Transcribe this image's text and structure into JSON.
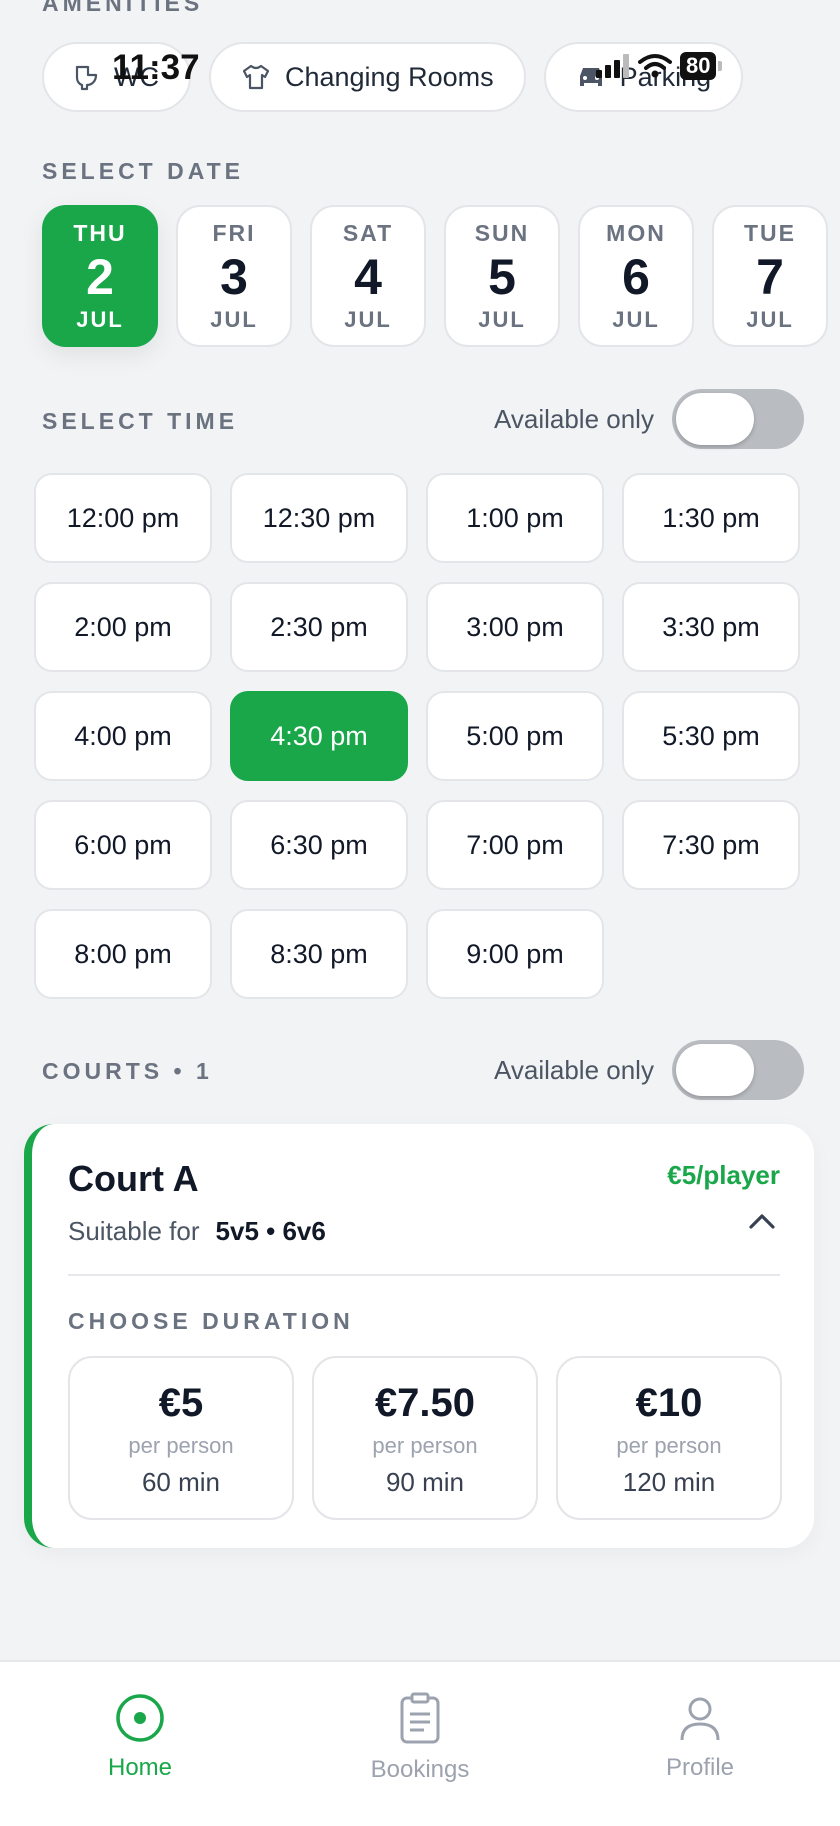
{
  "status_bar": {
    "time": "11:37",
    "battery": "80"
  },
  "amenities": {
    "label": "AMENITIES",
    "items": [
      {
        "label": "WC",
        "icon": "toilet-icon"
      },
      {
        "label": "Changing Rooms",
        "icon": "shirt-icon"
      },
      {
        "label": "Parking",
        "icon": "car-icon"
      }
    ]
  },
  "date": {
    "label": "SELECT DATE",
    "days": [
      {
        "dow": "THU",
        "num": "2",
        "month": "JUL",
        "selected": true
      },
      {
        "dow": "FRI",
        "num": "3",
        "month": "JUL"
      },
      {
        "dow": "SAT",
        "num": "4",
        "month": "JUL"
      },
      {
        "dow": "SUN",
        "num": "5",
        "month": "JUL"
      },
      {
        "dow": "MON",
        "num": "6",
        "month": "JUL"
      },
      {
        "dow": "TUE",
        "num": "7",
        "month": "JUL"
      }
    ]
  },
  "time": {
    "label": "SELECT TIME",
    "available_only_label": "Available only",
    "available_only": false,
    "slots": [
      "12:00 pm",
      "12:30 pm",
      "1:00 pm",
      "1:30 pm",
      "2:00 pm",
      "2:30 pm",
      "3:00 pm",
      "3:30 pm",
      "4:00 pm",
      "4:30 pm",
      "5:00 pm",
      "5:30 pm",
      "6:00 pm",
      "6:30 pm",
      "7:00 pm",
      "7:30 pm",
      "8:00 pm",
      "8:30 pm",
      "9:00 pm"
    ],
    "selected": "4:30 pm"
  },
  "courts": {
    "label": "COURTS • 1",
    "available_only_label": "Available only",
    "available_only": false,
    "items": [
      {
        "name": "Court A",
        "price": "€5/player",
        "suitable_label": "Suitable for",
        "suitable_value": "5v5 • 6v6",
        "duration_label": "CHOOSE DURATION",
        "durations": [
          {
            "price": "€5",
            "per": "per person",
            "minutes": "60 min"
          },
          {
            "price": "€7.50",
            "per": "per person",
            "minutes": "90 min"
          },
          {
            "price": "€10",
            "per": "per person",
            "minutes": "120 min"
          }
        ]
      }
    ]
  },
  "nav": {
    "items": [
      {
        "label": "Home",
        "icon": "home-icon",
        "active": true
      },
      {
        "label": "Bookings",
        "icon": "clipboard-icon"
      },
      {
        "label": "Profile",
        "icon": "profile-icon"
      }
    ]
  },
  "colors": {
    "accent": "#19a74a",
    "background": "#f2f3f5"
  }
}
